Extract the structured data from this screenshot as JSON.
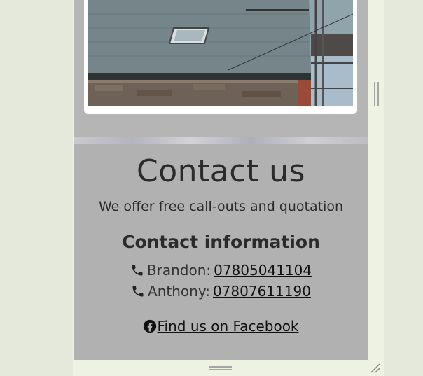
{
  "gallery": {
    "photo_alt": "Slate roof with skylight and scaffolding"
  },
  "contact": {
    "title": "Contact us",
    "subtitle": "We offer free call-outs and quotation",
    "info_heading": "Contact information",
    "contacts": [
      {
        "name_label": "Brandon:",
        "phone": "07805041104"
      },
      {
        "name_label": "Anthony:",
        "phone": "07807611190"
      }
    ],
    "facebook_label": " Find us on Facebook"
  },
  "colors": {
    "page_bg": "#e5e9dc",
    "section_bg": "#b1b1b1",
    "text": "#2b2b2b"
  }
}
